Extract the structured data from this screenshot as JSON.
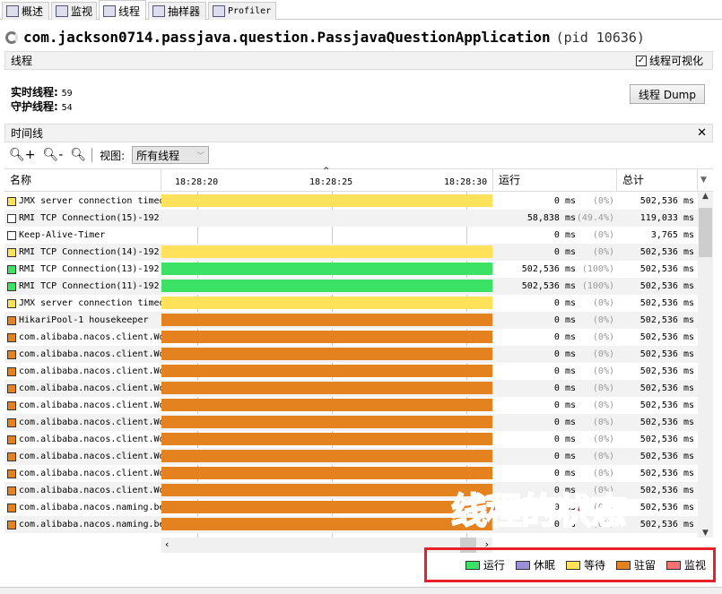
{
  "tabs": [
    {
      "label": "概述",
      "icon": "info-icon"
    },
    {
      "label": "监视",
      "icon": "chart-icon"
    },
    {
      "label": "线程",
      "icon": "threads-icon",
      "active": true
    },
    {
      "label": "抽样器",
      "icon": "sampler-icon"
    },
    {
      "label": "Profiler",
      "icon": "clock-icon"
    }
  ],
  "app": {
    "title": "com.jackson0714.passjava.question.PassjavaQuestionApplication",
    "pid": "(pid 10636)"
  },
  "threads_section": {
    "title": "线程",
    "visualize_label": "线程可视化",
    "visualize_checked": true,
    "live_label": "实时线程:",
    "live_value": "59",
    "daemon_label": "守护线程:",
    "daemon_value": "54",
    "dump_button": "线程 Dump"
  },
  "timeline_section": {
    "title": "时间线",
    "view_label": "视图:",
    "view_value": "所有线程"
  },
  "columns": {
    "name": "名称",
    "run": "运行",
    "total": "总计",
    "ticks": [
      "18:28:20",
      "18:28:25",
      "18:28:30"
    ]
  },
  "colors": {
    "running": "#3ce265",
    "sleeping": "#9a8fd9",
    "wait": "#ffe15a",
    "park": "#e58220",
    "monitor": "#f87070",
    "none": "#ffffff"
  },
  "rows": [
    {
      "name": "JMX server connection timeout",
      "state": "wait",
      "run": "0 ms",
      "pct": "(0%)",
      "total": "502,536 ms"
    },
    {
      "name": "RMI TCP Connection(15)-192.",
      "state": "none",
      "run": "58,838 ms",
      "pct": "(49.4%)",
      "total": "119,033 ms"
    },
    {
      "name": "Keep-Alive-Timer",
      "state": "none",
      "run": "0 ms",
      "pct": "(0%)",
      "total": "3,765 ms"
    },
    {
      "name": "RMI TCP Connection(14)-192.",
      "state": "wait",
      "run": "0 ms",
      "pct": "(0%)",
      "total": "502,536 ms"
    },
    {
      "name": "RMI TCP Connection(13)-192.",
      "state": "running",
      "run": "502,536 ms",
      "pct": "(100%)",
      "total": "502,536 ms"
    },
    {
      "name": "RMI TCP Connection(11)-192.",
      "state": "running",
      "run": "502,536 ms",
      "pct": "(100%)",
      "total": "502,536 ms"
    },
    {
      "name": "JMX server connection timeout",
      "state": "wait",
      "run": "0 ms",
      "pct": "(0%)",
      "total": "502,536 ms"
    },
    {
      "name": "HikariPool-1 housekeeper",
      "state": "park",
      "run": "0 ms",
      "pct": "(0%)",
      "total": "502,536 ms"
    },
    {
      "name": "com.alibaba.nacos.client.Wo",
      "state": "park",
      "run": "0 ms",
      "pct": "(0%)",
      "total": "502,536 ms"
    },
    {
      "name": "com.alibaba.nacos.client.Wo",
      "state": "park",
      "run": "0 ms",
      "pct": "(0%)",
      "total": "502,536 ms"
    },
    {
      "name": "com.alibaba.nacos.client.Wo",
      "state": "park",
      "run": "0 ms",
      "pct": "(0%)",
      "total": "502,536 ms"
    },
    {
      "name": "com.alibaba.nacos.client.Wo",
      "state": "park",
      "run": "0 ms",
      "pct": "(0%)",
      "total": "502,536 ms"
    },
    {
      "name": "com.alibaba.nacos.client.Wo",
      "state": "park",
      "run": "0 ms",
      "pct": "(0%)",
      "total": "502,536 ms"
    },
    {
      "name": "com.alibaba.nacos.client.Wo",
      "state": "park",
      "run": "0 ms",
      "pct": "(0%)",
      "total": "502,536 ms"
    },
    {
      "name": "com.alibaba.nacos.client.Wo",
      "state": "park",
      "run": "0 ms",
      "pct": "(0%)",
      "total": "502,536 ms"
    },
    {
      "name": "com.alibaba.nacos.client.Wo",
      "state": "park",
      "run": "0 ms",
      "pct": "(0%)",
      "total": "502,536 ms"
    },
    {
      "name": "com.alibaba.nacos.client.Wo",
      "state": "park",
      "run": "0 ms",
      "pct": "(0%)",
      "total": "502,536 ms"
    },
    {
      "name": "com.alibaba.nacos.client.Wo",
      "state": "park",
      "run": "0 ms",
      "pct": "(0%)",
      "total": "502,536 ms"
    },
    {
      "name": "com.alibaba.nacos.naming.be",
      "state": "park",
      "run": "0 ms",
      "pct": "(0%)",
      "total": "502,536 ms"
    },
    {
      "name": "com.alibaba.nacos.naming.be",
      "state": "park",
      "run": "0 ms",
      "pct": "(0%)",
      "total": "502,536 ms"
    }
  ],
  "legend": [
    {
      "label": "运行",
      "state": "running"
    },
    {
      "label": "休眠",
      "state": "sleeping"
    },
    {
      "label": "等待",
      "state": "wait"
    },
    {
      "label": "驻留",
      "state": "park"
    },
    {
      "label": "监视",
      "state": "monitor"
    }
  ],
  "annotation": "线程的状态"
}
